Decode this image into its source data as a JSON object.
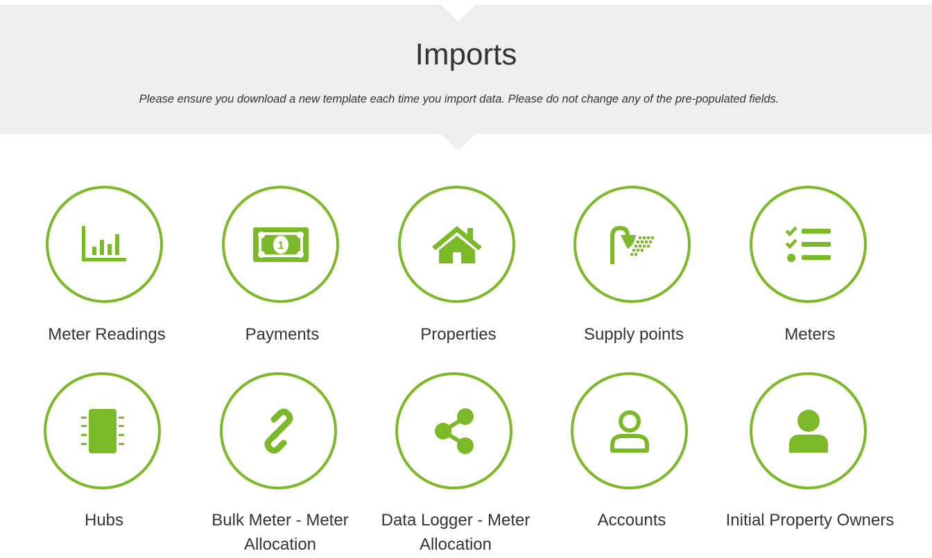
{
  "header": {
    "title": "Imports",
    "subtitle": "Please ensure you download a new template each time you import data. Please do not change any of the pre-populated fields."
  },
  "theme": {
    "accent": "#7cb928",
    "banner_bg": "#eeeeee",
    "text": "#333333"
  },
  "imports": [
    {
      "label": "Meter Readings",
      "icon": "bar-chart-icon"
    },
    {
      "label": "Payments",
      "icon": "banknote-icon"
    },
    {
      "label": "Properties",
      "icon": "house-icon"
    },
    {
      "label": "Supply points",
      "icon": "shower-icon"
    },
    {
      "label": "Meters",
      "icon": "checklist-icon"
    },
    {
      "label": "Hubs",
      "icon": "chip-icon"
    },
    {
      "label": "Bulk Meter - Meter Allocation",
      "icon": "link-icon"
    },
    {
      "label": "Data Logger - Meter Allocation",
      "icon": "share-icon"
    },
    {
      "label": "Accounts",
      "icon": "user-outline-icon"
    },
    {
      "label": "Initial Property Owners",
      "icon": "user-icon"
    }
  ]
}
